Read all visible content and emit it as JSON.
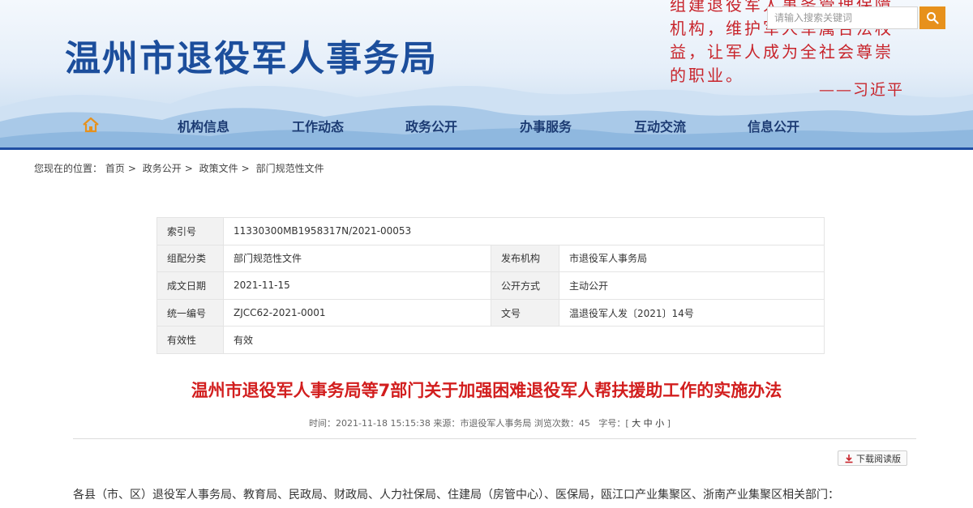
{
  "header": {
    "site_title": "温州市退役军人事务局",
    "quote_lines": [
      "组建退役军人事务管理保障",
      "机构，维护军人军属合法权",
      "益，让军人成为全社会尊崇",
      "的职业。"
    ],
    "quote_author": "——习近平",
    "search_placeholder": "请输入搜索关键词",
    "search_button_color": "#e7911c",
    "title_color": "#1c4e9c",
    "quote_color": "#c8242b"
  },
  "nav": {
    "home_icon": "home-icon",
    "items": [
      "机构信息",
      "工作动态",
      "政务公开",
      "办事服务",
      "互动交流",
      "信息公开"
    ],
    "accent_color": "#1f4ea3"
  },
  "breadcrumb": {
    "prefix": "您现在的位置：",
    "items": [
      "首页",
      "政务公开",
      "政策文件",
      "部门规范性文件"
    ]
  },
  "meta": {
    "index_label": "索引号",
    "index_value": "11330300MB1958317N/2021-00053",
    "category_label": "组配分类",
    "category_value": "部门规范性文件",
    "publisher_label": "发布机构",
    "publisher_value": "市退役军人事务局",
    "date_label": "成文日期",
    "date_value": "2021-11-15",
    "open_label": "公开方式",
    "open_value": "主动公开",
    "code_label": "统一编号",
    "code_value": "ZJCC62-2021-0001",
    "doc_label": "文号",
    "doc_value": "温退役军人发〔2021〕14号",
    "valid_label": "有效性",
    "valid_value": "有效"
  },
  "article": {
    "title": "温州市退役军人事务局等7部门关于加强困难退役军人帮扶援助工作的实施办法",
    "title_color": "#d21e1e",
    "time_label": "时间：",
    "time_value": "2021-11-18 15:15:38",
    "source_label": "来源：",
    "source_value": "市退役军人事务局",
    "views_label": "浏览次数：",
    "views_value": "45",
    "font_label": "字号：",
    "font_large": "大",
    "font_medium": "中",
    "font_small": "小",
    "download_label": "下载阅读版",
    "download_icon": "download-icon",
    "first_line": "各县（市、区）退役军人事务局、教育局、民政局、财政局、人力社保局、住建局（房管中心）、医保局，瓯江口产业集聚区、浙南产业集聚区相关部门："
  }
}
